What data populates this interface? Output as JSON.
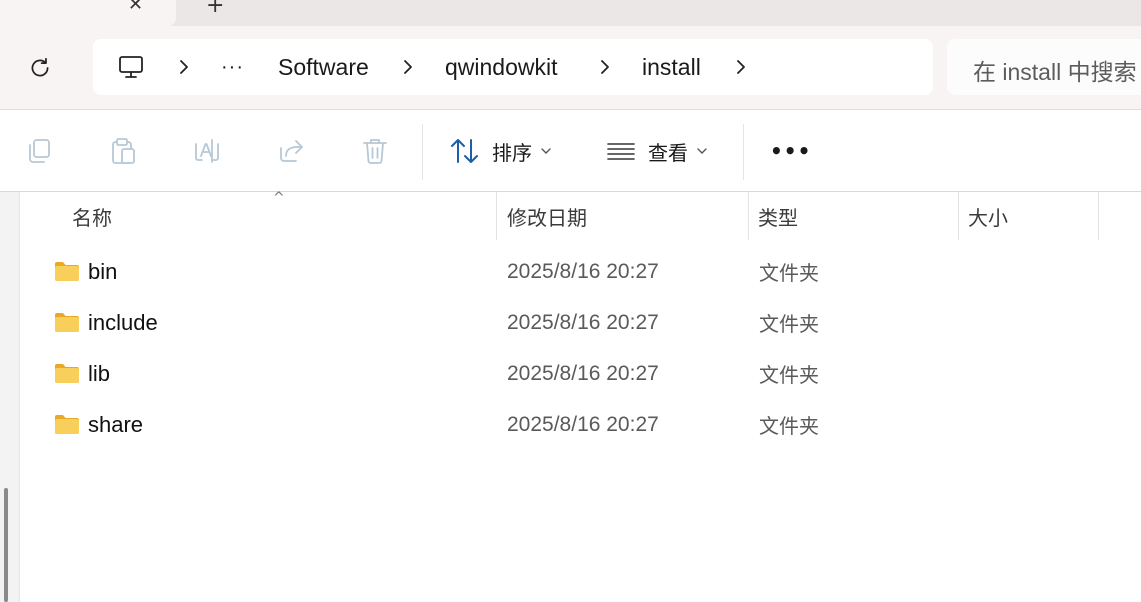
{
  "tabs": {
    "close_glyph": "✕",
    "new_tab_glyph": "+"
  },
  "breadcrumb": {
    "icons": [
      "this-pc-icon",
      "chevron-right-icon",
      "more-icon"
    ],
    "overflow": "···",
    "items": [
      "Software",
      "qwindowkit",
      "install"
    ]
  },
  "search": {
    "placeholder": "在 install 中搜索"
  },
  "commandbar": {
    "icons": [
      "copy-icon",
      "paste-icon",
      "rename-icon",
      "share-icon",
      "delete-icon"
    ],
    "sort_label": "排序",
    "view_label": "查看",
    "more_glyph": "•••"
  },
  "columns": {
    "name": "名称",
    "date": "修改日期",
    "type": "类型",
    "size": "大小"
  },
  "files": [
    {
      "name": "bin",
      "modified": "2025/8/16 20:27",
      "type": "文件夹"
    },
    {
      "name": "include",
      "modified": "2025/8/16 20:27",
      "type": "文件夹"
    },
    {
      "name": "lib",
      "modified": "2025/8/16 20:27",
      "type": "文件夹"
    },
    {
      "name": "share",
      "modified": "2025/8/16 20:27",
      "type": "文件夹"
    }
  ],
  "colors": {
    "accent": "#005fb8",
    "folder": "#f6c343",
    "disabled_icon": "#b6c8d6"
  }
}
